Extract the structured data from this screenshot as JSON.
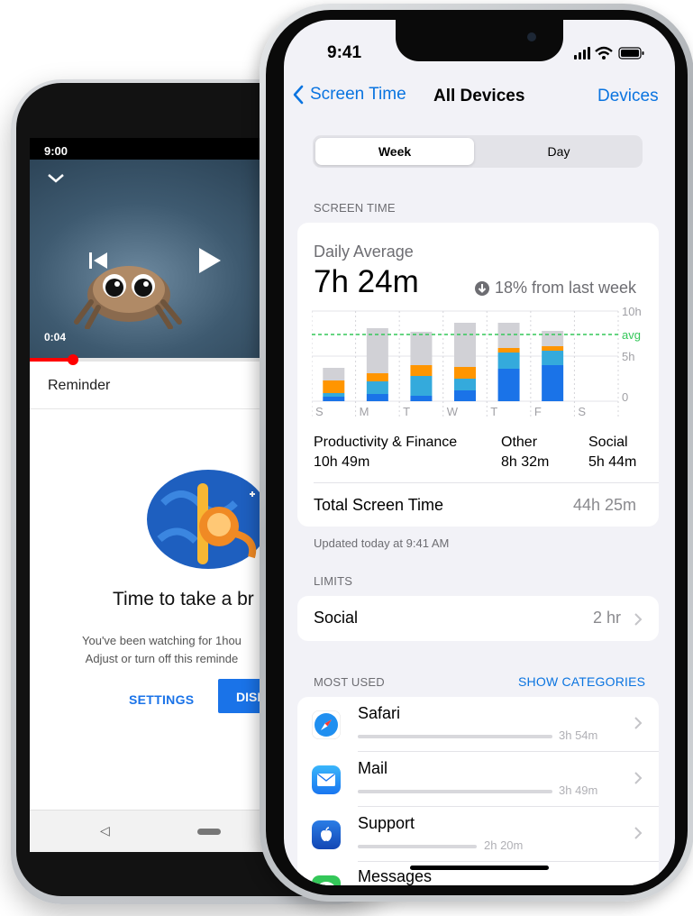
{
  "android": {
    "status_time": "9:00",
    "video_time": "0:04",
    "reminder_label": "Reminder",
    "break_title": "Time to take a br",
    "break_body_line1": "You've been watching for 1hou",
    "break_body_line2": "Adjust or turn off this reminde",
    "settings_label": "SETTINGS",
    "dismiss_label": "DISM",
    "nav_back_glyph": "◁",
    "video_progress_percent": 16
  },
  "iphone": {
    "status": {
      "time": "9:41"
    },
    "nav": {
      "back_label": "Screen Time",
      "title": "All Devices",
      "right_label": "Devices"
    },
    "segment": {
      "week_label": "Week",
      "day_label": "Day",
      "selected": "Week"
    },
    "screen_time": {
      "section_label": "SCREEN TIME",
      "daily_average_label": "Daily Average",
      "daily_average_value": "7h 24m",
      "change_text": "18% from last week",
      "legend": [
        {
          "label": "Productivity & Finance",
          "value": "10h 49m",
          "color": "#1a73e8"
        },
        {
          "label": "Other",
          "value": "8h 32m",
          "color": "#34aadc"
        },
        {
          "label": "Social",
          "value": "5h 44m",
          "color": "#ff9500"
        }
      ],
      "total_label": "Total Screen Time",
      "total_value": "44h 25m",
      "updated_text": "Updated today at 9:41 AM"
    },
    "limits": {
      "section_label": "LIMITS",
      "item_label": "Social",
      "item_value": "2 hr"
    },
    "most_used": {
      "section_label": "MOST USED",
      "show_categories_label": "SHOW CATEGORIES",
      "apps": [
        {
          "name": "Safari",
          "time": "3h 54m",
          "icon": "safari-icon"
        },
        {
          "name": "Mail",
          "time": "3h 49m",
          "icon": "mail-icon"
        },
        {
          "name": "Support",
          "time": "2h 20m",
          "icon": "apple-support-icon"
        },
        {
          "name": "Messages",
          "icon": "messages-icon"
        }
      ]
    }
  },
  "chart_data": {
    "type": "bar",
    "categories": [
      "S",
      "M",
      "T",
      "W",
      "T",
      "F",
      "S"
    ],
    "y_tick_labels": [
      "10h",
      "5h",
      "0"
    ],
    "avg_label": "avg",
    "ylim": [
      0,
      10
    ],
    "avg_value": 7.4,
    "series": [
      {
        "name": "Productivity & Finance",
        "values": [
          0.5,
          0.8,
          0.6,
          1.2,
          3.6,
          4.0,
          0
        ]
      },
      {
        "name": "Other",
        "values": [
          0.4,
          1.4,
          2.2,
          1.3,
          1.8,
          1.6,
          0
        ]
      },
      {
        "name": "Social",
        "values": [
          1.4,
          0.9,
          1.2,
          1.3,
          0.5,
          0.5,
          0
        ]
      },
      {
        "values": [
          1.4,
          5.0,
          3.7,
          4.9,
          2.8,
          1.7,
          0
        ]
      }
    ],
    "colors": [
      "#1a73e8",
      "#34aadc",
      "#ff9500",
      "#d1d1d6"
    ],
    "grid": true
  }
}
